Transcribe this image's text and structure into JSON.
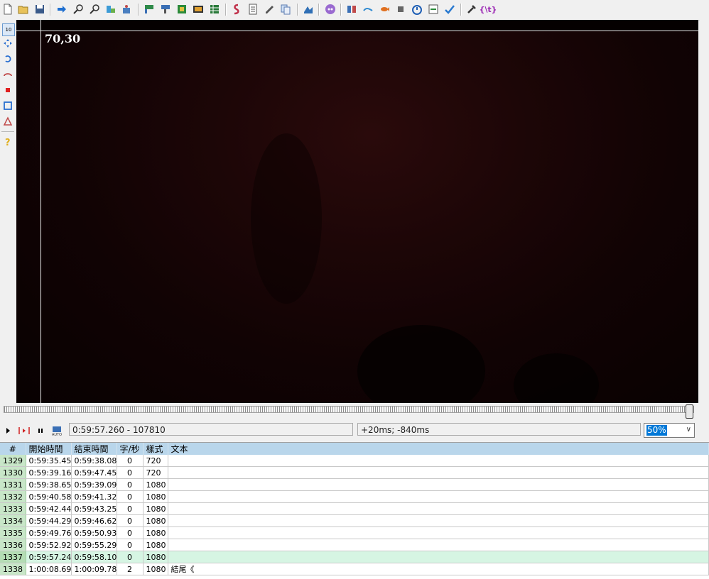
{
  "video": {
    "coords": "70,30"
  },
  "controls": {
    "time_display": "0:59:57.260 - 107810",
    "offset_display": "+20ms; -840ms",
    "zoom_value": "50%"
  },
  "grid": {
    "headers": [
      "#",
      "開始時間",
      "結束時間",
      "字/秒",
      "樣式",
      "文本"
    ],
    "rows": [
      {
        "num": "1329",
        "start": "0:59:35.45",
        "end": "0:59:38.08",
        "cps": "0",
        "style": "720",
        "text": ""
      },
      {
        "num": "1330",
        "start": "0:59:39.16",
        "end": "0:59:47.45",
        "cps": "0",
        "style": "720",
        "text": ""
      },
      {
        "num": "1331",
        "start": "0:59:38.65",
        "end": "0:59:39.09",
        "cps": "0",
        "style": "1080",
        "text": ""
      },
      {
        "num": "1332",
        "start": "0:59:40.58",
        "end": "0:59:41.32",
        "cps": "0",
        "style": "1080",
        "text": ""
      },
      {
        "num": "1333",
        "start": "0:59:42.44",
        "end": "0:59:43.25",
        "cps": "0",
        "style": "1080",
        "text": ""
      },
      {
        "num": "1334",
        "start": "0:59:44.29",
        "end": "0:59:46.62",
        "cps": "0",
        "style": "1080",
        "text": ""
      },
      {
        "num": "1335",
        "start": "0:59:49.76",
        "end": "0:59:50.93",
        "cps": "0",
        "style": "1080",
        "text": ""
      },
      {
        "num": "1336",
        "start": "0:59:52.92",
        "end": "0:59:55.29",
        "cps": "0",
        "style": "1080",
        "text": ""
      },
      {
        "num": "1337",
        "start": "0:59:57.24",
        "end": "0:59:58.10",
        "cps": "0",
        "style": "1080",
        "text": ""
      },
      {
        "num": "1338",
        "start": "1:00:08.69",
        "end": "1:00:09.78",
        "cps": "2",
        "style": "1080",
        "text": "結尾《"
      }
    ]
  },
  "toolbar": {
    "tag_label": "{\\t}"
  },
  "side": {
    "std_label": "10"
  }
}
